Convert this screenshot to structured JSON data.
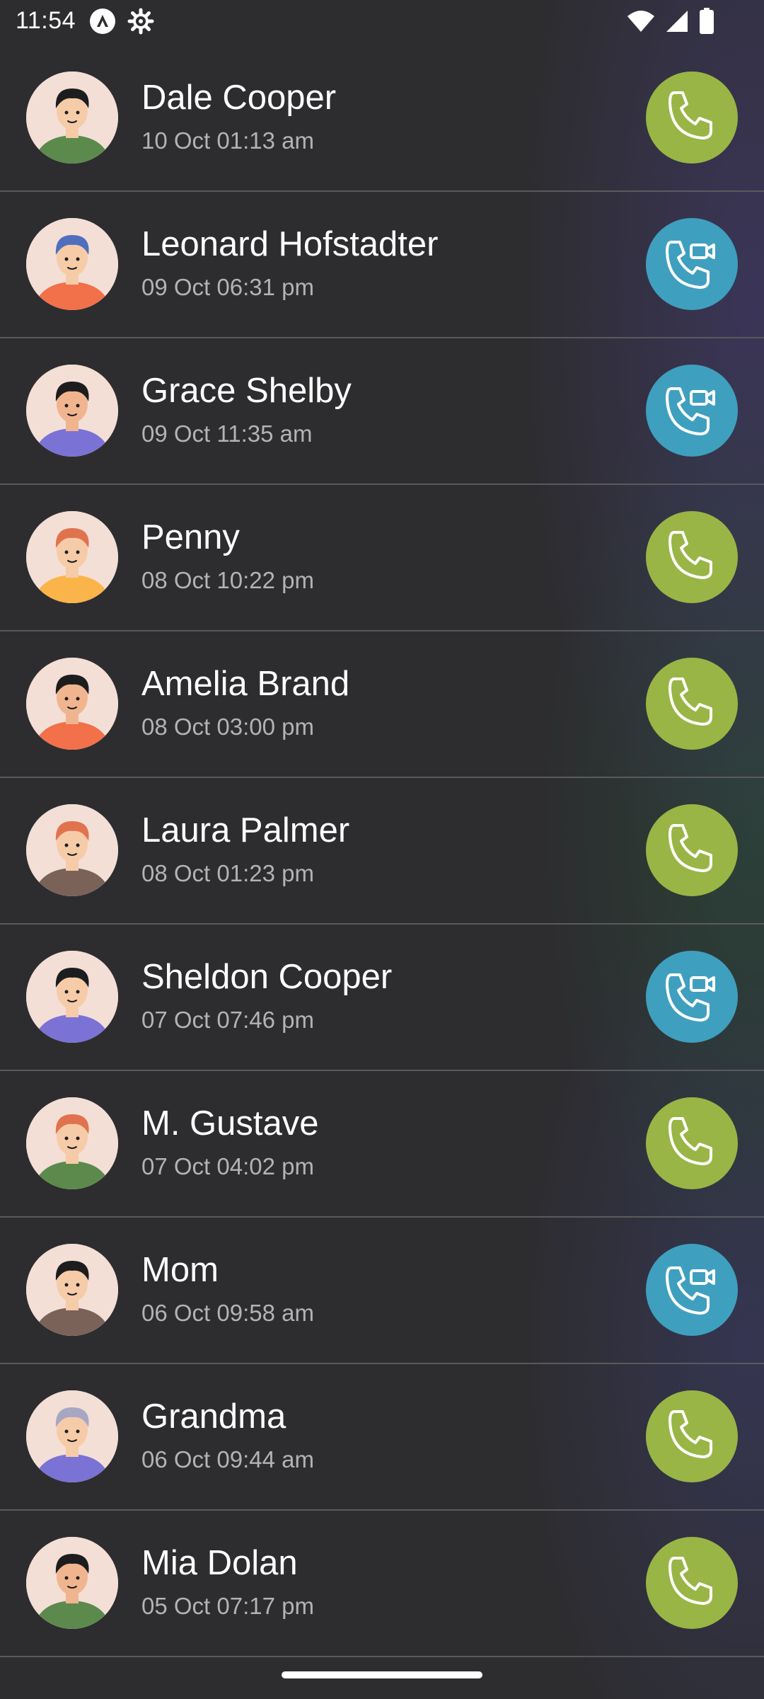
{
  "status_bar": {
    "time": "11:54",
    "left_icons": [
      "android-auto-icon",
      "settings-gear-icon"
    ],
    "right_icons": [
      "wifi-icon",
      "cellular-signal-icon",
      "battery-icon"
    ]
  },
  "colors": {
    "background": "#2d2d30",
    "audio_call_button": "#99b545",
    "video_call_button": "#3f9fbf",
    "divider": "#5a5a5e",
    "secondary_text": "#b3b3b3"
  },
  "calls": [
    {
      "name": "Dale Cooper",
      "time": "10 Oct 01:13 am",
      "call_type": "audio",
      "avatar": {
        "skin": "#f6cba8",
        "hair": "#1d1d1f",
        "shirt": "#5b8a4c",
        "bg": "#f3dfd6"
      }
    },
    {
      "name": "Leonard Hofstadter",
      "time": "09 Oct 06:31 pm",
      "call_type": "video",
      "avatar": {
        "skin": "#f6cba8",
        "hair": "#4f6fbe",
        "shirt": "#f2704a",
        "bg": "#f3dfd6"
      }
    },
    {
      "name": "Grace Shelby",
      "time": "09 Oct 11:35 am",
      "call_type": "video",
      "avatar": {
        "skin": "#f0b58f",
        "hair": "#1d1d1f",
        "shirt": "#7b72d6",
        "bg": "#f3dfd6"
      }
    },
    {
      "name": "Penny",
      "time": "08 Oct 10:22 pm",
      "call_type": "audio",
      "avatar": {
        "skin": "#f6cba8",
        "hair": "#e0734e",
        "shirt": "#fbb44a",
        "bg": "#f3dfd6"
      }
    },
    {
      "name": "Amelia Brand",
      "time": "08 Oct 03:00 pm",
      "call_type": "audio",
      "avatar": {
        "skin": "#f0b58f",
        "hair": "#1d1d1f",
        "shirt": "#f2704a",
        "bg": "#f3dfd6"
      }
    },
    {
      "name": "Laura Palmer",
      "time": "08 Oct 01:23 pm",
      "call_type": "audio",
      "avatar": {
        "skin": "#f6cba8",
        "hair": "#e0734e",
        "shirt": "#7a6259",
        "bg": "#f3dfd6"
      }
    },
    {
      "name": "Sheldon Cooper",
      "time": "07 Oct 07:46 pm",
      "call_type": "video",
      "avatar": {
        "skin": "#f6cba8",
        "hair": "#1d1d1f",
        "shirt": "#7b72d6",
        "bg": "#f3dfd6"
      }
    },
    {
      "name": "M. Gustave",
      "time": "07 Oct 04:02 pm",
      "call_type": "audio",
      "avatar": {
        "skin": "#f6cba8",
        "hair": "#e0734e",
        "shirt": "#5b8a4c",
        "bg": "#f3dfd6"
      }
    },
    {
      "name": "Mom",
      "time": "06 Oct 09:58 am",
      "call_type": "video",
      "avatar": {
        "skin": "#f6cba8",
        "hair": "#1d1d1f",
        "shirt": "#7a6259",
        "bg": "#f3dfd6"
      }
    },
    {
      "name": "Grandma",
      "time": "06 Oct 09:44 am",
      "call_type": "audio",
      "avatar": {
        "skin": "#f6cba8",
        "hair": "#a7a7c4",
        "shirt": "#7b72d6",
        "bg": "#f3dfd6"
      }
    },
    {
      "name": "Mia Dolan",
      "time": "05 Oct 07:17 pm",
      "call_type": "audio",
      "avatar": {
        "skin": "#f0b58f",
        "hair": "#1d1d1f",
        "shirt": "#5b8a4c",
        "bg": "#f3dfd6"
      }
    }
  ]
}
